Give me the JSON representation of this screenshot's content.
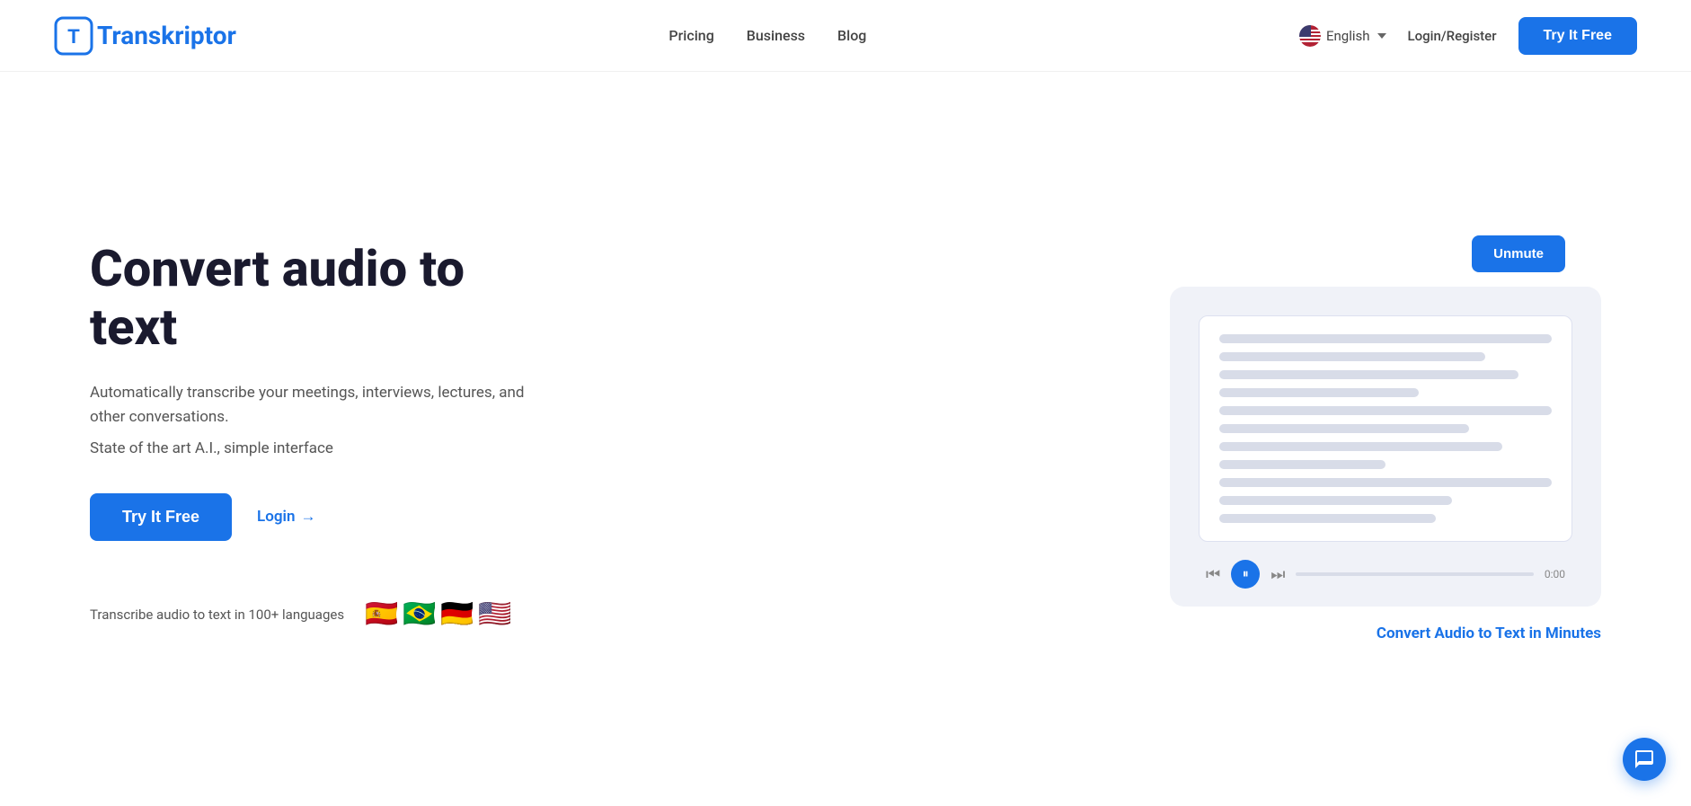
{
  "brand": {
    "name": "Transkriptor",
    "logo_letter": "T"
  },
  "navbar": {
    "pricing_label": "Pricing",
    "business_label": "Business",
    "blog_label": "Blog",
    "language_label": "English",
    "login_label": "Login/Register",
    "try_free_label": "Try It Free"
  },
  "hero": {
    "title": "Convert audio to text",
    "subtitle1": "Automatically transcribe your meetings, interviews, lectures, and other conversations.",
    "subtitle2": "State of the art A.I., simple interface",
    "try_free_label": "Try It Free",
    "login_label": "Login",
    "login_arrow": "→",
    "languages_text": "Transcribe audio to text in 100+ languages",
    "flags": [
      "🇪🇸",
      "🇧🇷",
      "🇩🇪",
      "🇺🇸"
    ]
  },
  "video_card": {
    "unmute_label": "Unmute",
    "caption": "Convert Audio to Text in Minutes",
    "player_time": "0:00"
  }
}
